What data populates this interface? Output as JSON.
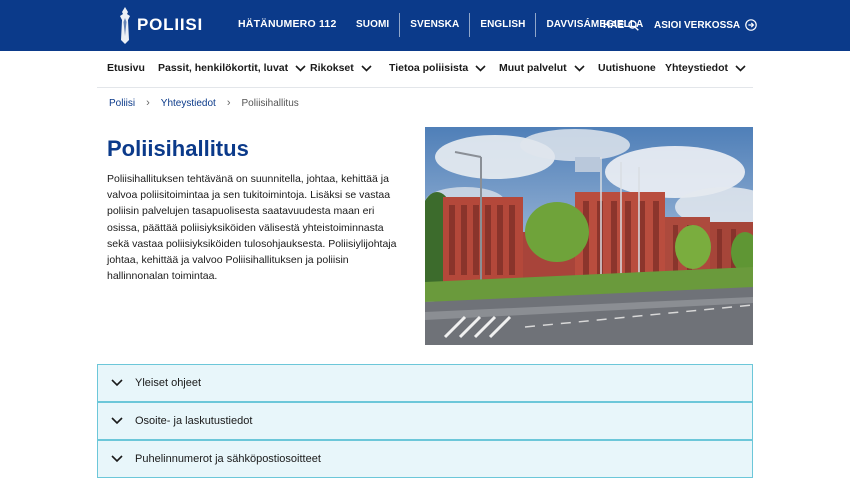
{
  "header": {
    "logo_text": "POLIISI",
    "emergency": "HÄTÄNUMERO 112",
    "languages": [
      "SUOMI",
      "SVENSKA",
      "ENGLISH",
      "DAVVISÁMEGIELLA"
    ],
    "search_label": "HAE",
    "services_label": "ASIOI VERKOSSA"
  },
  "nav": {
    "items": [
      {
        "label": "Etusivu",
        "dropdown": false
      },
      {
        "label": "Passit, henkilökortit, luvat",
        "dropdown": true
      },
      {
        "label": "Rikokset",
        "dropdown": true
      },
      {
        "label": "Tietoa poliisista",
        "dropdown": true
      },
      {
        "label": "Muut palvelut",
        "dropdown": true
      },
      {
        "label": "Uutishuone",
        "dropdown": false
      },
      {
        "label": "Yhteystiedot",
        "dropdown": true
      }
    ]
  },
  "breadcrumb": {
    "items": [
      "Poliisi",
      "Yhteystiedot"
    ],
    "current": "Poliisihallitus"
  },
  "page": {
    "title": "Poliisihallitus",
    "intro": "Poliisihallituksen tehtävänä on suunnitella, johtaa, kehittää ja valvoa poliisitoimintaa ja sen tukitoimintoja. Lisäksi se vastaa poliisin palvelujen tasapuolisesta saatavuudesta maan eri osissa, päättää poliisiyksiköiden välisestä yhteistoiminnasta sekä vastaa poliisiyksiköiden tulosohjauksesta. Poliisiylijohtaja johtaa, kehittää ja valvoo Poliisihallituksen ja poliisin hallinnonalan toimintaa."
  },
  "accordion": [
    {
      "label": "Yleiset ohjeet"
    },
    {
      "label": "Osoite- ja laskutustiedot"
    },
    {
      "label": "Puhelinnumerot ja sähköpostiosoitteet"
    }
  ],
  "colors": {
    "brand_blue": "#0b3a8a",
    "accordion_bg": "#e8f6fa",
    "accordion_border": "#6cc7d9"
  }
}
